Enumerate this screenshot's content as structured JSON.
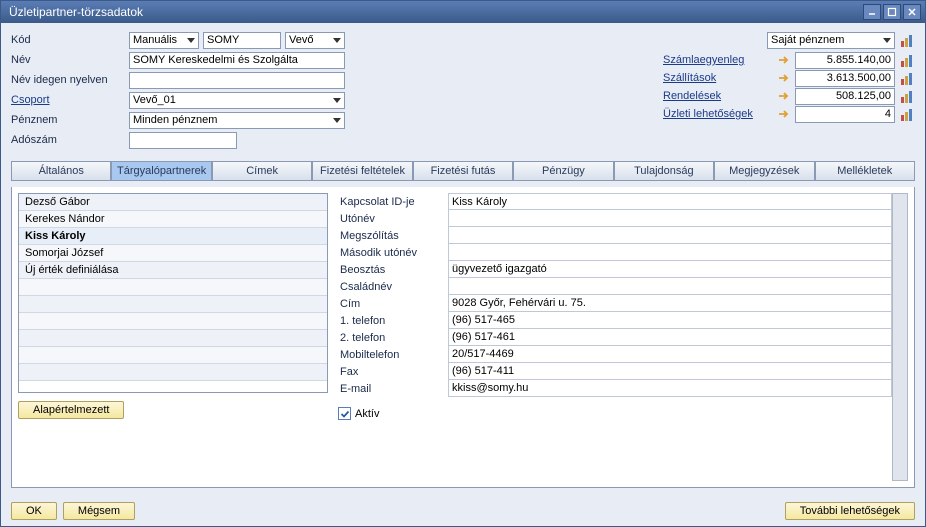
{
  "window": {
    "title": "Üzletipartner-törzsadatok"
  },
  "header": {
    "code_label": "Kód",
    "code_mode": "Manuális",
    "code_value": "SOMY",
    "type_value": "Vevő",
    "name_label": "Név",
    "name_value": "SOMY Kereskedelmi és Szolgálta",
    "foreign_name_label": "Név idegen nyelven",
    "foreign_name_value": "",
    "group_label": "Csoport",
    "group_value": "Vevő_01",
    "currency_label": "Pénznem",
    "currency_value": "Minden pénznem",
    "tax_label": "Adószám",
    "tax_value": ""
  },
  "summary": {
    "own_currency": "Saját pénznem",
    "rows": [
      {
        "label": "Számlaegyenleg",
        "value": "5.855.140,00"
      },
      {
        "label": "Szállítások",
        "value": "3.613.500,00"
      },
      {
        "label": "Rendelések",
        "value": "508.125,00"
      },
      {
        "label": "Üzleti lehetőségek",
        "value": "4"
      }
    ]
  },
  "tabs": {
    "items": [
      {
        "label": "Általános"
      },
      {
        "label": "Tárgyalópartnerek"
      },
      {
        "label": "Címek"
      },
      {
        "label": "Fizetési feltételek"
      },
      {
        "label": "Fizetési futás"
      },
      {
        "label": "Pénzügy"
      },
      {
        "label": "Tulajdonság"
      },
      {
        "label": "Megjegyzések"
      },
      {
        "label": "Mellékletek"
      }
    ],
    "active_index": 1
  },
  "contacts": {
    "list": [
      "Dezső Gábor",
      "Kerekes Nándor",
      "Kiss Károly",
      "Somorjai József",
      "Új érték definiálása"
    ],
    "selected_index": 2,
    "default_button": "Alapértelmezett",
    "active_label": "Aktív",
    "active_checked": true,
    "fields": [
      {
        "label": "Kapcsolat ID-je",
        "value": "Kiss Károly"
      },
      {
        "label": "Utónév",
        "value": ""
      },
      {
        "label": "Megszólítás",
        "value": ""
      },
      {
        "label": "Második utónév",
        "value": ""
      },
      {
        "label": "Beosztás",
        "value": "ügyvezető igazgató"
      },
      {
        "label": "Családnév",
        "value": ""
      },
      {
        "label": "Cím",
        "value": "9028 Győr, Fehérvári u. 75."
      },
      {
        "label": "1. telefon",
        "value": "(96) 517-465"
      },
      {
        "label": "2. telefon",
        "value": "(96) 517-461"
      },
      {
        "label": "Mobiltelefon",
        "value": "20/517-4469"
      },
      {
        "label": "Fax",
        "value": "(96) 517-411"
      },
      {
        "label": "E-mail",
        "value": "kkiss@somy.hu"
      }
    ]
  },
  "footer": {
    "ok": "OK",
    "cancel": "Mégsem",
    "more": "További lehetőségek"
  }
}
